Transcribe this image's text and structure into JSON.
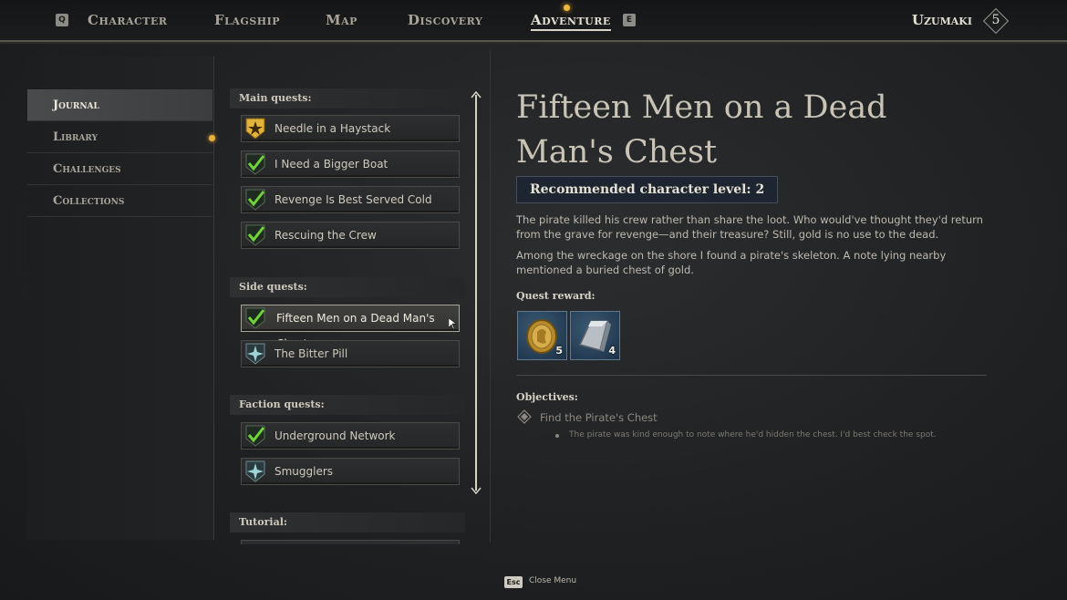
{
  "topbar": {
    "left_key": "Q",
    "right_key": "E",
    "tabs": [
      "Character",
      "Flagship",
      "Map",
      "Discovery",
      "Adventure"
    ],
    "active_tab": "Adventure",
    "player_name": "Uzumaki",
    "player_level": "5"
  },
  "sidebar": {
    "items": [
      "Journal",
      "Library",
      "Challenges",
      "Collections"
    ],
    "active": "Journal"
  },
  "quest_list": {
    "main_header": "Main quests:",
    "main": [
      "Needle in a Haystack",
      "I Need a Bigger Boat",
      "Revenge Is Best Served Cold",
      "Rescuing the Crew"
    ],
    "side_header": "Side quests:",
    "side": [
      "Fifteen Men on a Dead Man's Chest",
      "The Bitter Pill"
    ],
    "faction_header": "Faction quests:",
    "faction": [
      "Underground Network",
      "Smugglers"
    ],
    "tutorial_header": "Tutorial:"
  },
  "detail": {
    "title": "Fifteen Men on a Dead Man's Chest",
    "recommended_level": "Recommended character level: 2",
    "description_1": "The pirate killed his crew rather than share the loot. Who would've thought they'd return from the grave for revenge—and their treasure? Still, gold is no use to the dead.",
    "description_2": "Among the wreckage on the shore I found a pirate's skeleton. A note lying nearby mentioned a buried chest of gold.",
    "reward_label": "Quest reward:",
    "rewards": [
      {
        "icon": "gold-coin-icon",
        "count": "5"
      },
      {
        "icon": "silver-ingot-icon",
        "count": "4"
      }
    ],
    "objectives_label": "Objectives:",
    "objective": "Find the Pirate's Chest",
    "objective_note": "The pirate was kind enough to note where he'd hidden the chest. I'd best check the spot."
  },
  "footer": {
    "esc_key": "Esc",
    "close_label": "Close Menu"
  },
  "colors": {
    "accent_gold": "#f3b73a",
    "check_green": "#6fd23a",
    "side_quest_teal": "#9fd3d6"
  }
}
